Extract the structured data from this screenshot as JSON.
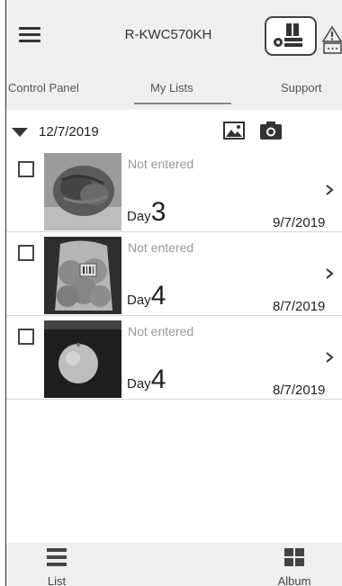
{
  "header": {
    "title": "R-KWC570KH",
    "menu_icon": "hamburger-menu-icon",
    "fridge_icon": "fridge-status-icon",
    "alert_icon": "warning-triangle-icon"
  },
  "tabs": [
    {
      "label": "Control Panel",
      "active": false
    },
    {
      "label": "My Lists",
      "active": true
    },
    {
      "label": "Support",
      "active": false
    }
  ],
  "group": {
    "date": "12/7/2019",
    "caret_icon": "caret-down-icon",
    "gallery_icon": "image-icon",
    "camera_icon": "camera-icon"
  },
  "items": [
    {
      "status": "Not entered",
      "day_label": "Day",
      "day_num": "3",
      "date": "9/7/2019",
      "thumb": "lettuce-photo"
    },
    {
      "status": "Not entered",
      "day_label": "Day",
      "day_num": "4",
      "date": "8/7/2019",
      "thumb": "bagged-tomatoes-photo"
    },
    {
      "status": "Not entered",
      "day_label": "Day",
      "day_num": "4",
      "date": "8/7/2019",
      "thumb": "orange-photo"
    }
  ],
  "bottom_nav": {
    "list_label": "List",
    "album_label": "Album"
  },
  "colors": {
    "header_bg": "#efefef",
    "text": "#222222",
    "muted": "#9a9a9a"
  }
}
